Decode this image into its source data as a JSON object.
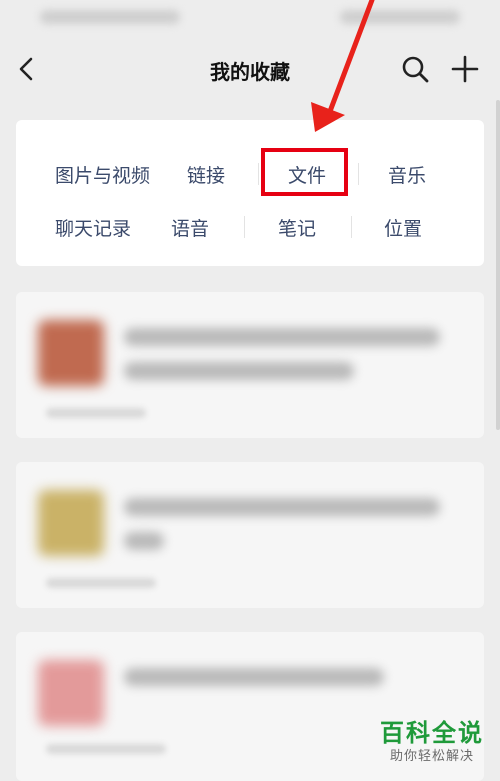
{
  "header": {
    "title": "我的收藏",
    "back_icon": "chevron-left-icon",
    "search_icon": "search-icon",
    "add_icon": "plus-icon"
  },
  "categories": [
    {
      "label": "图片与视频"
    },
    {
      "label": "链接"
    },
    {
      "label": "文件"
    },
    {
      "label": "音乐"
    },
    {
      "label": "聊天记录"
    },
    {
      "label": "语音"
    },
    {
      "label": "笔记"
    },
    {
      "label": "位置"
    }
  ],
  "annotation": {
    "highlight_color": "#e60012",
    "arrow_color": "#e8221b"
  },
  "watermark": {
    "title": "百科全说",
    "subtitle": "助你轻松解决"
  }
}
